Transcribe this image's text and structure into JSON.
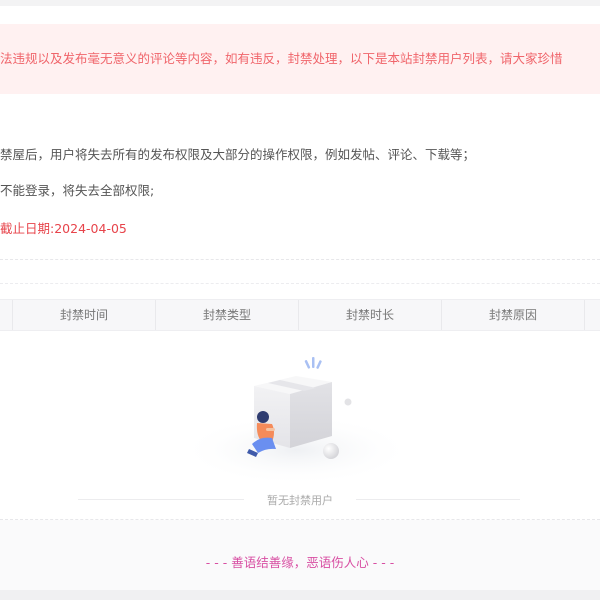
{
  "notice": {
    "text": "法违规以及发布毫无意义的评论等内容，如有违反，封禁处理，以下是本站封禁用户列表，请大家珍惜"
  },
  "rules": {
    "line1": "禁屋后，用户将失去所有的发布权限及大部分的操作权限，例如发帖、评论、下载等；",
    "line2": "不能登录，将失去全部权限;",
    "deadline_label": "截止日期:",
    "deadline_date": "2024-04-05"
  },
  "table": {
    "headers": [
      "封禁时间",
      "封禁类型",
      "封禁时长",
      "封禁原因"
    ]
  },
  "empty": {
    "text": "暂无封禁用户",
    "illustration": "person-sitting-by-box-illustration"
  },
  "footer": {
    "slogan": "- - - 善语结善缘，恶语伤人心 - - -"
  },
  "colors": {
    "notice_bg": "#fff1f1",
    "notice_text": "#f0656b",
    "deadline": "#e7444b",
    "slogan": "#d84fa3"
  }
}
